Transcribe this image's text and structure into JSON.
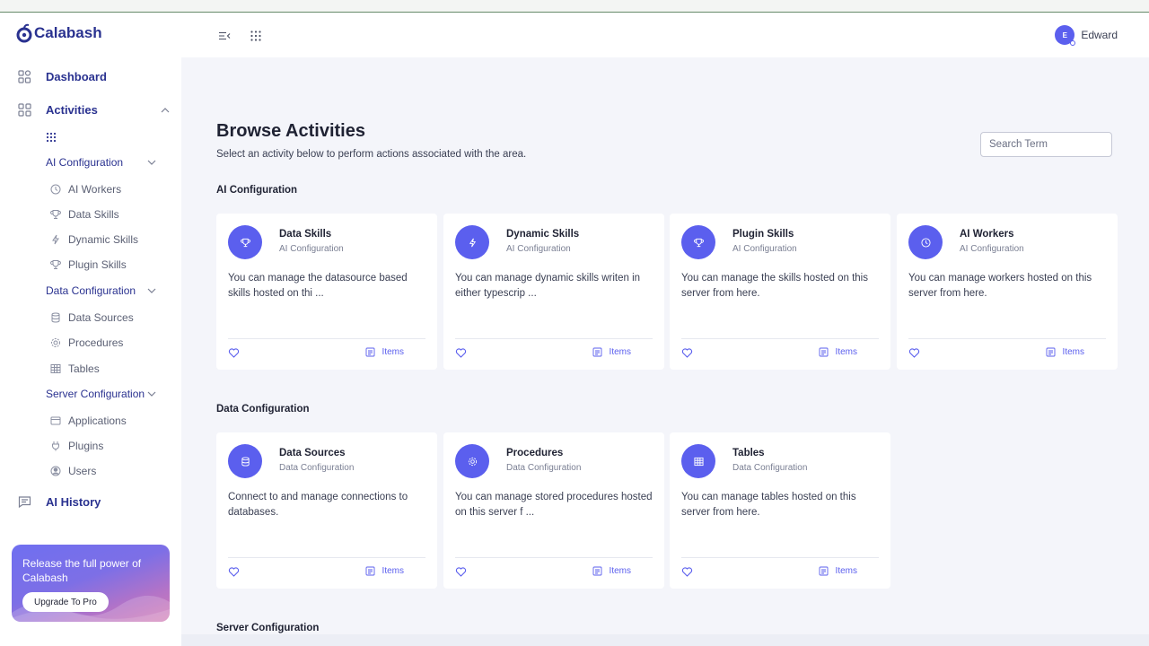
{
  "app": {
    "name": "Calabash"
  },
  "colors": {
    "brand": "#2a3290",
    "accent": "#5b5fee",
    "background": "#f4f5fa"
  },
  "sidebar": {
    "dashboard": {
      "label": "Dashboard",
      "icon": "dashboard-icon"
    },
    "activities": {
      "label": "Activities",
      "icon": "grid-icon"
    },
    "ai_configuration": {
      "label": "AI Configuration",
      "items": [
        {
          "label": "AI Workers",
          "icon": "clock-icon"
        },
        {
          "label": "Data Skills",
          "icon": "trophy-icon"
        },
        {
          "label": "Dynamic Skills",
          "icon": "lightning-icon"
        },
        {
          "label": "Plugin Skills",
          "icon": "trophy-icon"
        }
      ]
    },
    "data_configuration": {
      "label": "Data Configuration",
      "items": [
        {
          "label": "Data Sources",
          "icon": "database-icon"
        },
        {
          "label": "Procedures",
          "icon": "gear-icon"
        },
        {
          "label": "Tables",
          "icon": "table-icon"
        }
      ]
    },
    "server_configuration": {
      "label": "Server Configuration",
      "items": [
        {
          "label": "Applications",
          "icon": "window-icon"
        },
        {
          "label": "Plugins",
          "icon": "plug-icon"
        },
        {
          "label": "Users",
          "icon": "user-circle-icon"
        }
      ]
    },
    "ai_history": {
      "label": "AI History",
      "icon": "chat-icon"
    },
    "promo": {
      "text": "Release the full power of Calabash",
      "button": "Upgrade To Pro"
    }
  },
  "header": {
    "user_initial": "E",
    "user_name": "Edward"
  },
  "main": {
    "title": "Browse Activities",
    "subtitle": "Select an activity below to perform actions associated with the area.",
    "search_placeholder": "Search Term",
    "sections": [
      {
        "title": "AI Configuration",
        "cards": [
          {
            "title": "Data Skills",
            "category": "AI Configuration",
            "description": "You can manage the datasource based skills hosted on thi ...",
            "icon": "trophy-icon",
            "items_label": "Items"
          },
          {
            "title": "Dynamic Skills",
            "category": "AI Configuration",
            "description": "You can manage dynamic skills writen in either typescrip ...",
            "icon": "lightning-icon",
            "items_label": "Items"
          },
          {
            "title": "Plugin Skills",
            "category": "AI Configuration",
            "description": "You can manage the skills hosted on this server from here.",
            "icon": "trophy-icon",
            "items_label": "Items"
          },
          {
            "title": "AI Workers",
            "category": "AI Configuration",
            "description": "You can manage workers hosted on this server from here.",
            "icon": "clock-icon",
            "items_label": "Items"
          }
        ]
      },
      {
        "title": "Data Configuration",
        "cards": [
          {
            "title": "Data Sources",
            "category": "Data Configuration",
            "description": "Connect to and manage connections to databases.",
            "icon": "database-icon",
            "items_label": "Items"
          },
          {
            "title": "Procedures",
            "category": "Data Configuration",
            "description": "You can manage stored procedures hosted on this server f ...",
            "icon": "gear-icon",
            "items_label": "Items"
          },
          {
            "title": "Tables",
            "category": "Data Configuration",
            "description": "You can manage tables hosted on this server from here.",
            "icon": "table-icon",
            "items_label": "Items"
          }
        ]
      },
      {
        "title": "Server Configuration",
        "cards": []
      }
    ]
  }
}
